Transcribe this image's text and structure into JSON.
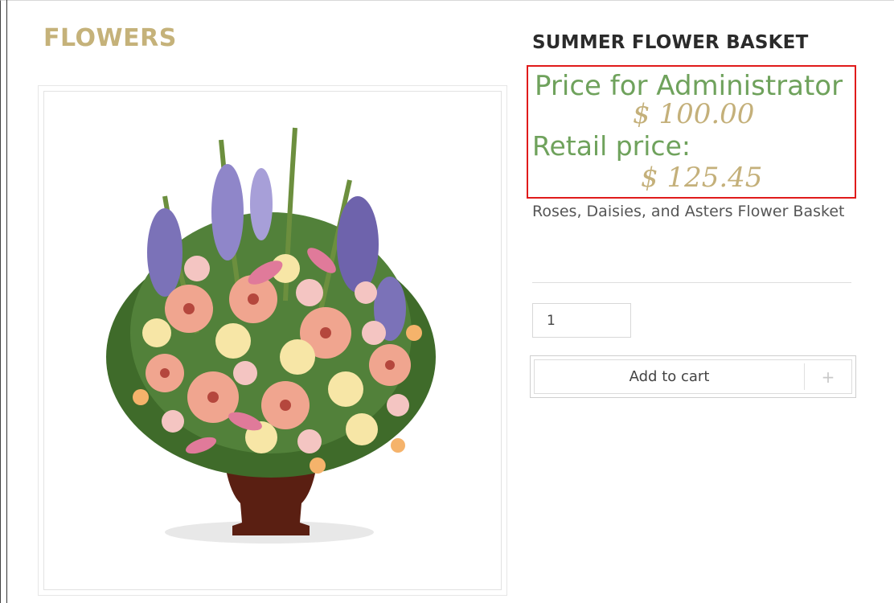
{
  "category": {
    "title": "FLOWERS"
  },
  "product": {
    "title": "SUMMER FLOWER BASKET",
    "image_alt": "Summer flower basket with roses, daisies and asters in a brown urn",
    "price_label_admin": "Price for Administrator",
    "price_admin": "$ 100.00",
    "price_label_retail": "Retail price:",
    "price_retail": "$ 125.45",
    "description": "Roses, Daisies, and Asters Flower Basket"
  },
  "cart": {
    "quantity": "1",
    "add_label": "Add to cart",
    "plus_symbol": "+"
  },
  "colors": {
    "accent_gold": "#c5b27a",
    "price_green": "#6fa25c",
    "highlight_red": "#e01b1b"
  }
}
